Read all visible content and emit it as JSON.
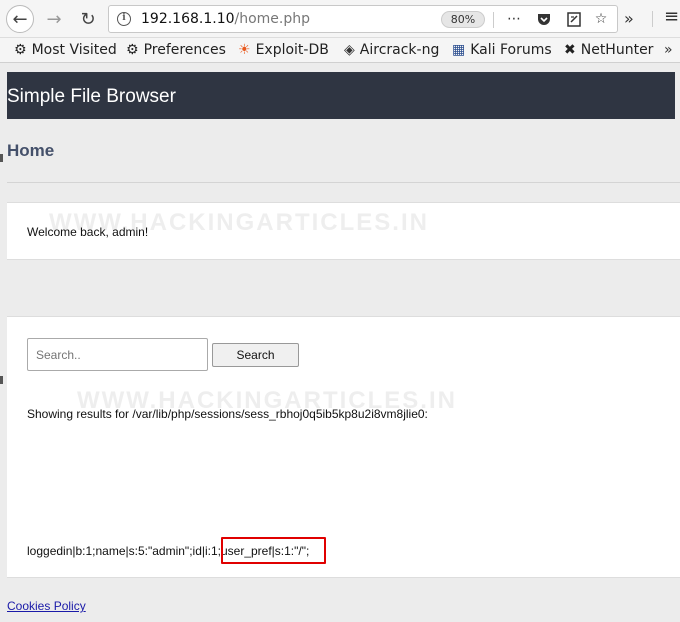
{
  "browser": {
    "url_host": "192.168.1.10",
    "url_path": "/home.php",
    "zoom": "80%",
    "bookmarks": [
      {
        "icon": "gear-icon",
        "label": "Most Visited"
      },
      {
        "icon": "gear-icon",
        "label": "Preferences"
      },
      {
        "icon": "exploit-db-icon",
        "label": "Exploit-DB"
      },
      {
        "icon": "aircrack-icon",
        "label": "Aircrack-ng"
      },
      {
        "icon": "kali-icon",
        "label": "Kali Forums"
      },
      {
        "icon": "nethunter-icon",
        "label": "NetHunter"
      }
    ]
  },
  "app": {
    "title": "Simple File Browser",
    "heading": "Home",
    "welcome": "Welcome back, admin!",
    "watermark": "WWW.HACKINGARTICLES.IN",
    "search": {
      "placeholder": "Search..",
      "button_label": "Search"
    },
    "results_text": "Showing results for /var/lib/php/sessions/sess_rbhoj0q5ib5kp8u2i8vm8jlie0:",
    "session_prefix": "loggedin|b:1;name|s:5:\"admin\";id|i:1",
    "session_highlight": ";user_pref|s:1:\"/\";",
    "cookies_link": "Cookies Policy",
    "highlight_color": "#e00000"
  }
}
